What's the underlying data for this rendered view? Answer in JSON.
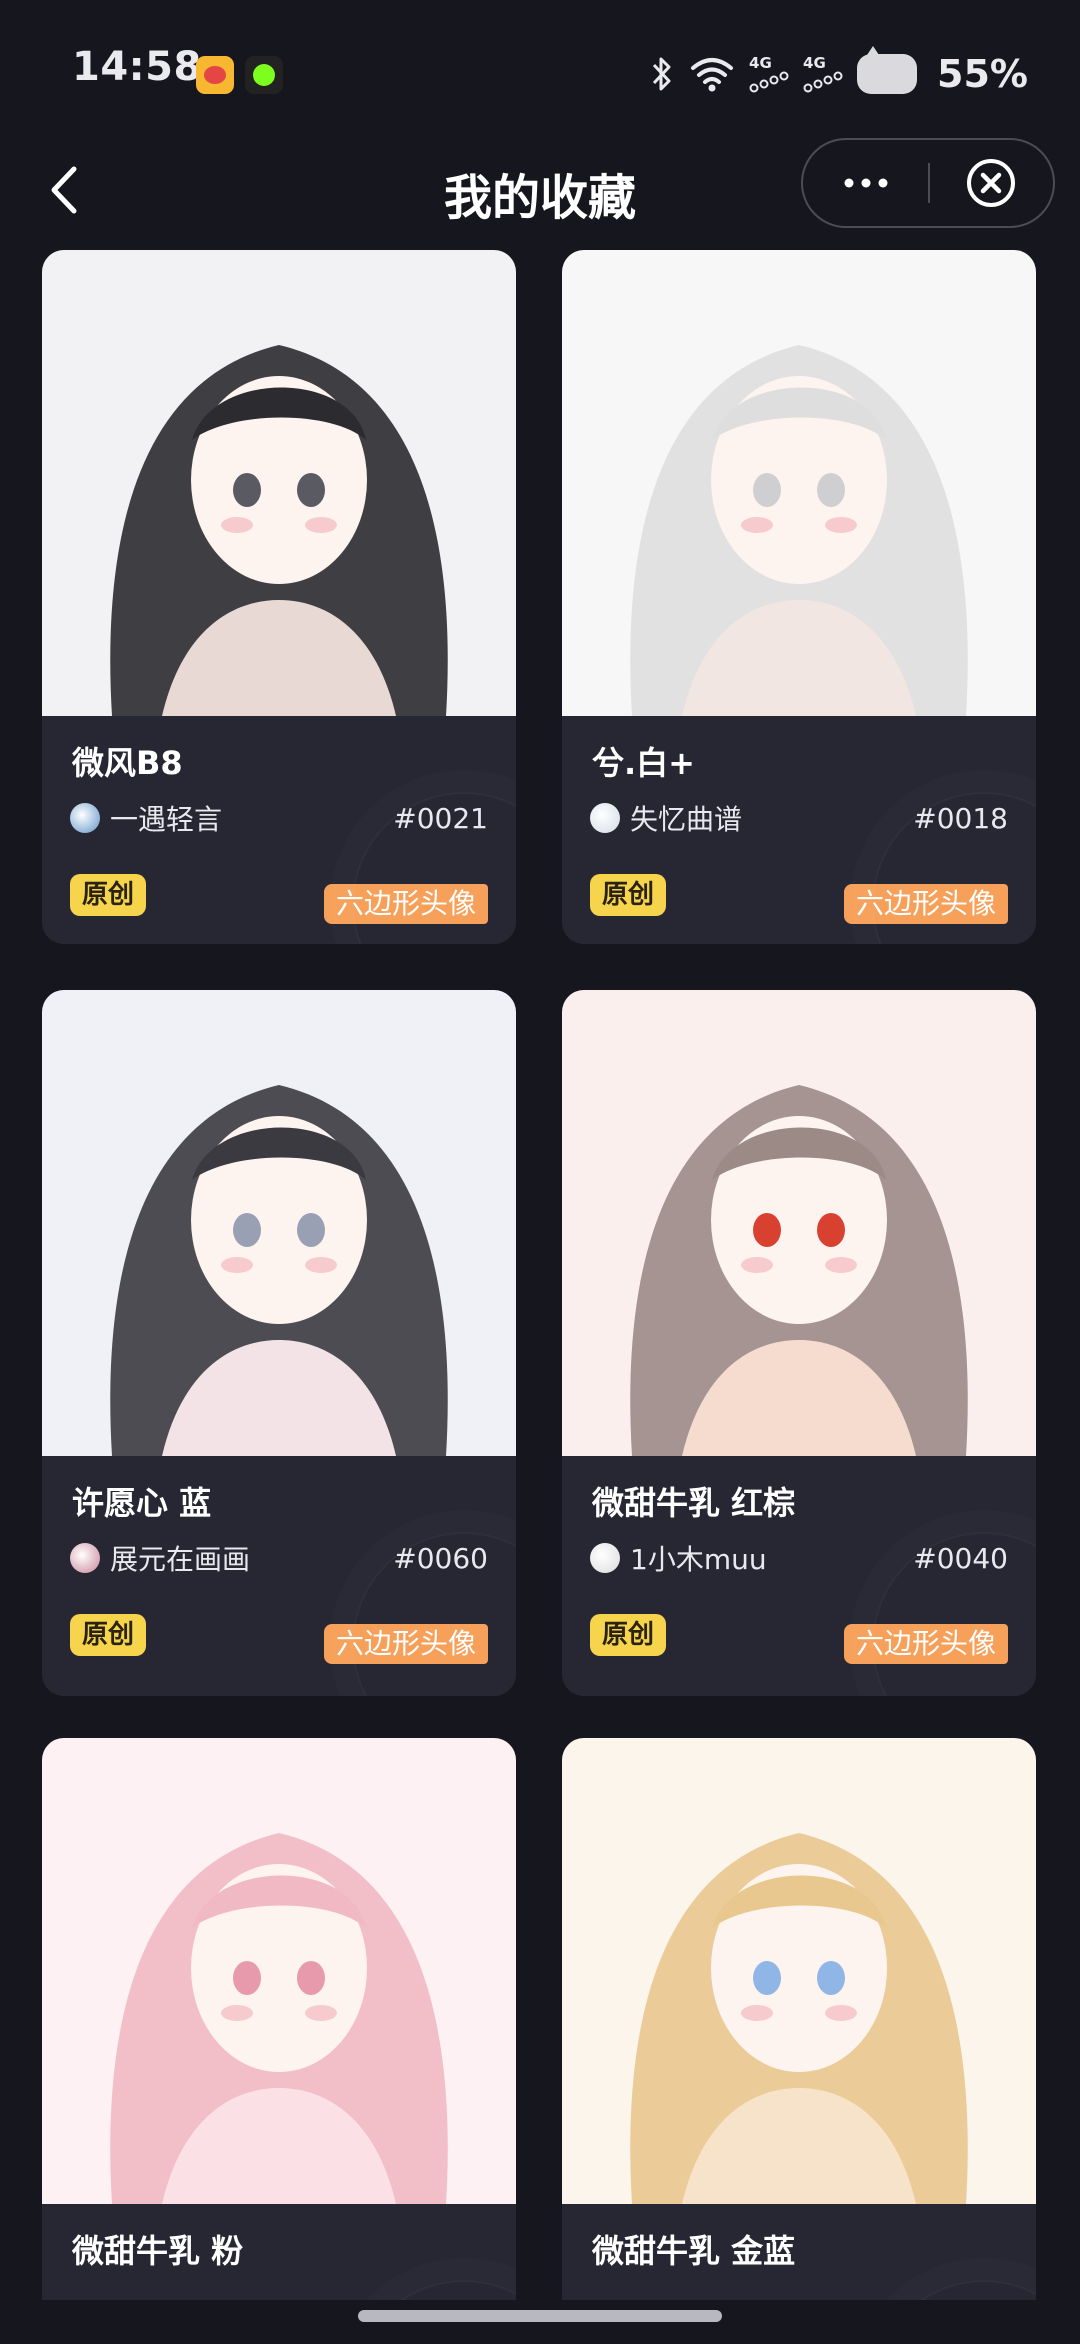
{
  "status_bar": {
    "time": "14:58",
    "network_1": "4G",
    "network_2": "4G",
    "battery": "55%",
    "icons": [
      "weibo-app-icon",
      "green-dot-app-icon",
      "bluetooth-icon",
      "wifi-icon",
      "signal-icon",
      "signal-icon",
      "battery-cat-icon"
    ]
  },
  "nav": {
    "title": "我的收藏",
    "back_icon": "chevron-left-icon",
    "more_icon": "more-dots-icon",
    "close_icon": "close-circle-icon"
  },
  "cards": [
    {
      "title": "微风B8",
      "author": "一遇轻言",
      "number": "#0021",
      "tag_left": "原创",
      "tag_right": "六边形头像",
      "palette": [
        "#f2f2f5",
        "#2b2b30",
        "#5a5a63",
        "#e9d9d4"
      ],
      "avatar_color": "#8fb4d8"
    },
    {
      "title": "兮.白+",
      "author": "失忆曲谱",
      "number": "#0018",
      "tag_left": "原创",
      "tag_right": "六边形头像",
      "palette": [
        "#f7f7f7",
        "#dedede",
        "#cfcfd2",
        "#f2e6e3"
      ],
      "avatar_color": "#dfe6ee"
    },
    {
      "title": "许愿心 蓝",
      "author": "展元在画画",
      "number": "#0060",
      "tag_left": "原创",
      "tag_right": "六边形头像",
      "palette": [
        "#f0f1f6",
        "#3b3a40",
        "#9aa0b3",
        "#f3e3e6"
      ],
      "avatar_color": "#d9a9b6"
    },
    {
      "title": "微甜牛乳 红棕",
      "author": "1小木muu",
      "number": "#0040",
      "tag_left": "原创",
      "tag_right": "六边形头像",
      "palette": [
        "#fbefee",
        "#9b8a86",
        "#d8402f",
        "#f6dccf"
      ],
      "avatar_color": "#e6e6e6"
    },
    {
      "title": "微甜牛乳 粉",
      "author": "",
      "number": "",
      "tag_left": "",
      "tag_right": "",
      "palette": [
        "#fdf1f3",
        "#f1b9c4",
        "#e79aab",
        "#fbe1e6"
      ],
      "avatar_color": ""
    },
    {
      "title": "微甜牛乳 金蓝",
      "author": "",
      "number": "",
      "tag_left": "",
      "tag_right": "",
      "palette": [
        "#fbf5ec",
        "#e9c88f",
        "#8fb6e6",
        "#f7e3c9"
      ],
      "avatar_color": ""
    }
  ]
}
